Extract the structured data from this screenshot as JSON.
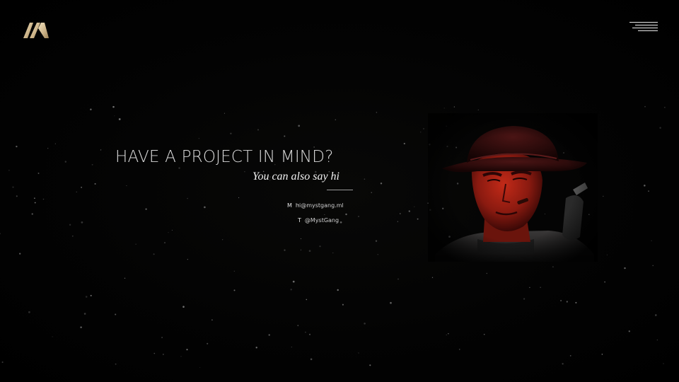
{
  "brand": {
    "logo_icon": "mountain-m-logo-icon",
    "accent_color": "#cdb58a"
  },
  "nav": {
    "menu_icon": "hamburger-menu-icon"
  },
  "contact": {
    "headline": "HAVE A PROJECT IN MIND?",
    "subhead": "You can also say hi",
    "rows": [
      {
        "key": "M",
        "value": "hi@mystgang.ml"
      },
      {
        "key": "T",
        "value": "@MystGang"
      }
    ]
  },
  "hero_image": {
    "subject": "red-tinted cowboy portrait",
    "tint_color": "#b01a10"
  },
  "background": {
    "color": "#000000",
    "dot_color": "#8a8a8a"
  }
}
